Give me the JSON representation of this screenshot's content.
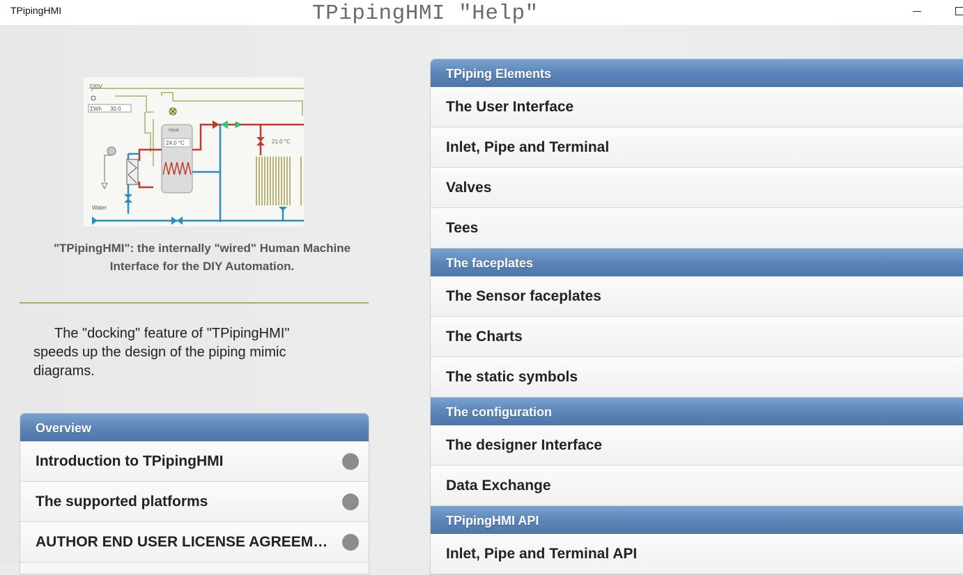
{
  "window": {
    "app_name": "TPipingHMI",
    "heading": "TPipingHMI \"Help\""
  },
  "mimic": {
    "voltage_label": "220V",
    "energy_label": "ΣWh",
    "energy_value": "30.0",
    "heat_label": "Heat",
    "tank_temp": "24.0 °C",
    "room_temp": "21.0 °C",
    "water_label": "Water"
  },
  "intro": {
    "caption": "\"TPipingHMI\":    the internally \"wired\" Human Machine Interface for the DIY Automation.",
    "docking_text": "The \"docking\" feature of \"TPipingHMI\" speeds up the design of the piping mimic diagrams."
  },
  "overview": {
    "header": "Overview",
    "items": [
      {
        "label": "Introduction to TPipingHMI"
      },
      {
        "label": "The supported platforms"
      },
      {
        "label": "AUTHOR END USER LICENSE AGREEMENT"
      }
    ]
  },
  "groups": [
    {
      "header": "TPiping Elements",
      "items": [
        "The User Interface",
        "Inlet, Pipe and Terminal",
        "Valves",
        "Tees"
      ]
    },
    {
      "header": "The faceplates",
      "items": [
        "The Sensor faceplates",
        "The Charts",
        "The static symbols"
      ]
    },
    {
      "header": "The configuration",
      "items": [
        "The designer Interface",
        "Data Exchange"
      ]
    },
    {
      "header": "TPipingHMI API",
      "items": [
        "Inlet, Pipe and Terminal API"
      ]
    }
  ]
}
